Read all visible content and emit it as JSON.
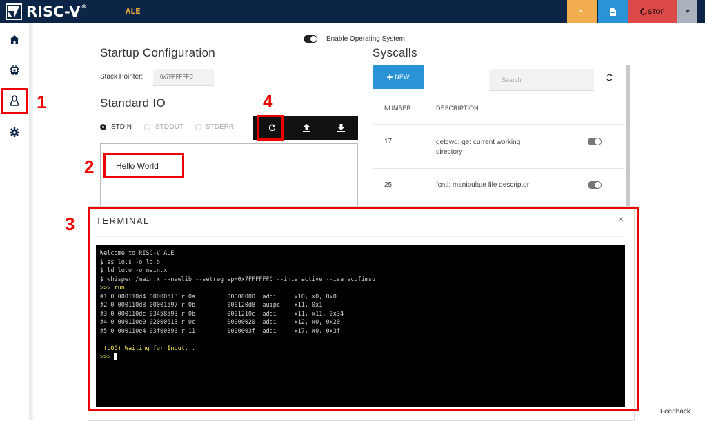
{
  "topbar": {
    "logo_text": "RISC-V",
    "logo_reg": "®",
    "app_name": "ALE",
    "terminal_button_label": ">_",
    "stop_label": "STOP",
    "colors": {
      "bar": "#0c2445",
      "terminal": "#f2ad4e",
      "file": "#2a93d5",
      "stop": "#db4a48",
      "more": "#aab2bd"
    }
  },
  "sidebar": {
    "items": [
      {
        "name": "home",
        "icon": "home-icon"
      },
      {
        "name": "cpu",
        "icon": "chip-icon"
      },
      {
        "name": "os",
        "icon": "linux-penguin-icon"
      },
      {
        "name": "settings",
        "icon": "gear-icon"
      }
    ]
  },
  "os_toggle": {
    "label": "Enable Operating System",
    "enabled": true
  },
  "startup": {
    "title": "Startup Configuration",
    "stack_pointer_label": "Stack Pointer:",
    "stack_pointer_value": "0x7FFFFFFC"
  },
  "stdio": {
    "title": "Standard IO",
    "options": [
      "STDIN",
      "STDOUT",
      "STDERR"
    ],
    "selected": "STDIN",
    "content": "Hello World",
    "buttons": [
      "refresh-icon",
      "upload-icon",
      "download-icon"
    ]
  },
  "syscalls": {
    "title": "Syscalls",
    "new_label": "NEW",
    "search_placeholder": "Search",
    "headers": [
      "NUMBER",
      "DESCRIPTION"
    ],
    "rows": [
      {
        "number": "17",
        "description": "getcwd: get current working directory",
        "enabled": false
      },
      {
        "number": "25",
        "description": "fcntl: manipulate file descriptor",
        "enabled": false
      }
    ]
  },
  "terminal": {
    "title": "TERMINAL",
    "close_label": "×",
    "lines": [
      "Welcome to RISC-V ALE",
      "$ as lo.s -o lo.o",
      "$ ld lo.o -o main.x",
      "$ whisper /main.x --newlib --setreg sp=0x7FFFFFFC --interactive --isa acdfimsu",
      ">>> run",
      "#1 0 000110d4 00000513 r 0a         00000000  addi     x10, x0, 0x0",
      "#2 0 000110d8 00001597 r 0b         000120d8  auipc    x11, 0x1",
      "#3 0 000110dc 03458593 r 0b         0001210c  addi     x11, x11, 0x34",
      "#4 0 000110e0 02000613 r 0c         00000020  addi     x12, x0, 0x20",
      "#5 0 000110e4 03f00893 r 11         0000003f  addi     x17, x0, 0x3f"
    ],
    "log_line": " (LOG) Waiting for Input...",
    "prompt": ">>> "
  },
  "annotations": [
    "1",
    "2",
    "3",
    "4"
  ],
  "feedback_label": "Feedback"
}
